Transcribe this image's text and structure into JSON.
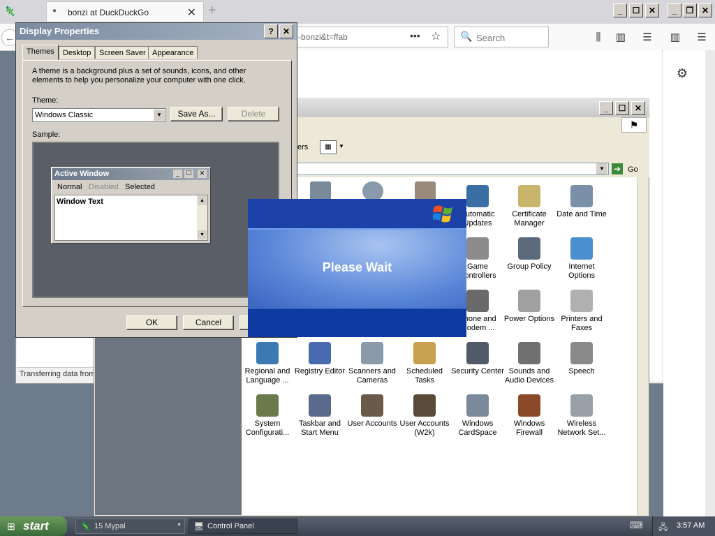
{
  "firefox": {
    "tab_title": "bonzi at DuckDuckGo",
    "url_fragment": "-bonzi&t=ffab",
    "search_placeholder": "Search",
    "status": "Transferring data from"
  },
  "display_properties": {
    "title": "Display Properties",
    "tabs": [
      "Themes",
      "Desktop",
      "Screen Saver",
      "Appearance"
    ],
    "description": "A theme is a background plus a set of sounds, icons, and other elements to help you personalize your computer with one click.",
    "theme_label": "Theme:",
    "theme_value": "Windows Classic",
    "save_as": "Save As...",
    "delete": "Delete",
    "sample_label": "Sample:",
    "sample": {
      "active_window": "Active Window",
      "menu": [
        "Normal",
        "Disabled",
        "Selected"
      ],
      "window_text": "Window Text"
    },
    "ok": "OK",
    "cancel": "Cancel"
  },
  "control_panel": {
    "toolbar_fragment": "ers",
    "go": "Go",
    "icons": [
      {
        "label": "Automatic Updates",
        "color": "#3a6ea5"
      },
      {
        "label": "Certificate Manager",
        "color": "#c8b46a"
      },
      {
        "label": "Date and Time",
        "color": "#7a8fa8"
      },
      {
        "label": "Game Controllers",
        "color": "#8c8c8c"
      },
      {
        "label": "Group Policy",
        "color": "#5a6a7a"
      },
      {
        "label": "Internet Options",
        "color": "#4a90d0"
      },
      {
        "label": "Phone and Modem ...",
        "color": "#6a6a6a"
      },
      {
        "label": "Power Options",
        "color": "#a0a0a0"
      },
      {
        "label": "Printers and Faxes",
        "color": "#b0b0b0"
      },
      {
        "label": "Regional and Language ...",
        "color": "#3a7ab0"
      },
      {
        "label": "Registry Editor",
        "color": "#4a6ab0"
      },
      {
        "label": "Scanners and Cameras",
        "color": "#8a9aa8"
      },
      {
        "label": "Scheduled Tasks",
        "color": "#c8a050"
      },
      {
        "label": "Security Center",
        "color": "#505a68"
      },
      {
        "label": "Sounds and Audio Devices",
        "color": "#707070"
      },
      {
        "label": "Speech",
        "color": "#8a8a8a"
      },
      {
        "label": "System Configurati...",
        "color": "#6a7a4a"
      },
      {
        "label": "Taskbar and Start Menu",
        "color": "#5a6a8a"
      },
      {
        "label": "User Accounts",
        "color": "#6a5a4a"
      },
      {
        "label": "User Accounts (W2k)",
        "color": "#5a4a3a"
      },
      {
        "label": "Windows CardSpace",
        "color": "#7a8a9a"
      },
      {
        "label": "Windows Firewall",
        "color": "#8a4a2a"
      },
      {
        "label": "Wireless Network Set...",
        "color": "#9aa0a8"
      }
    ]
  },
  "please_wait": {
    "text": "Please Wait"
  },
  "taskbar": {
    "start": "start",
    "items": [
      {
        "label": "15 Mypal"
      },
      {
        "label": "Control Panel"
      }
    ],
    "clock": "3:57 AM"
  }
}
